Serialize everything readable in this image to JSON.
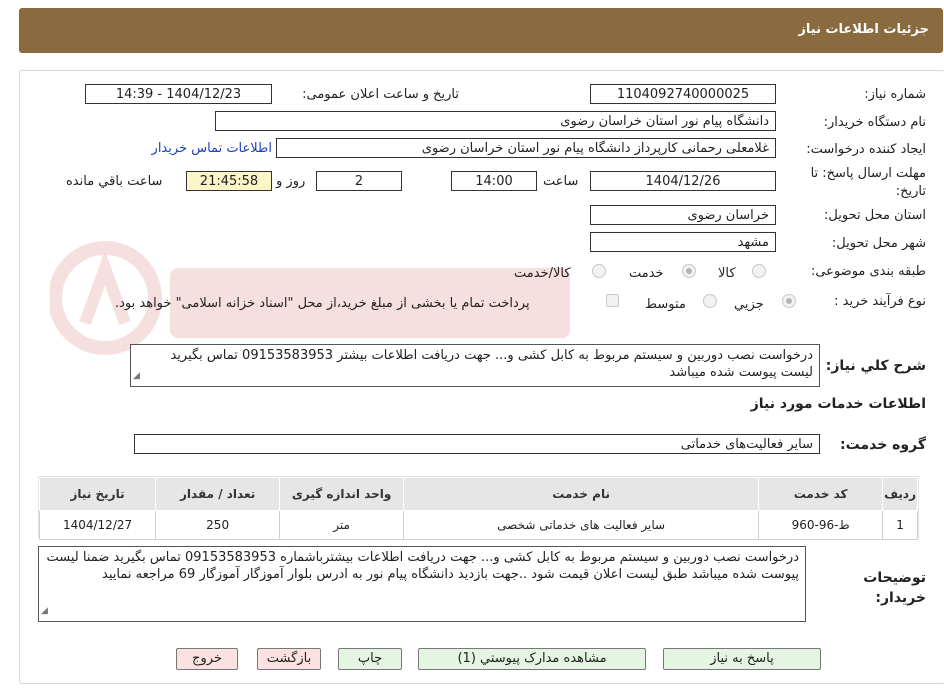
{
  "header": {
    "title": "جزئیات اطلاعات نیاز"
  },
  "form": {
    "need_number": {
      "label": "شماره نیاز:",
      "value": "1104092740000025"
    },
    "announce_datetime": {
      "label": "تاریخ و ساعت اعلان عمومی:",
      "value": "1404/12/23 - 14:39"
    },
    "buyer_org": {
      "label": "نام دستگاه خریدار:",
      "value": "دانشگاه پیام نور استان خراسان رضوی"
    },
    "requester": {
      "label": "ایجاد کننده درخواست:",
      "value": "غلامعلی رحمانی کارپرداز دانشگاه پیام نور استان خراسان رضوی",
      "contact_link": "اطلاعات تماس خریدار"
    },
    "deadline": {
      "label": "مهلت ارسال پاسخ: تا تاریخ:",
      "date": "1404/12/26",
      "time_label": "ساعت",
      "time": "14:00",
      "days": "2",
      "days_label": "روز و",
      "remaining": "21:45:58",
      "remaining_label": "ساعت باقي مانده"
    },
    "delivery_province": {
      "label": "استان محل تحویل:",
      "value": "خراسان رضوی"
    },
    "delivery_city": {
      "label": "شهر محل تحویل:",
      "value": "مشهد"
    },
    "category": {
      "label": "طبقه بندی موضوعی:",
      "options": [
        "کالا",
        "خدمت",
        "کالا/خدمت"
      ],
      "selected": "خدمت"
    },
    "purchase_type": {
      "label": "نوع فرآیند خرید :",
      "options": [
        "جزیي",
        "متوسط"
      ],
      "selected": "جزیي",
      "note": "پرداخت تمام یا بخشی از مبلغ خرید،از محل \"اسناد خزانه اسلامی\" خواهد بود."
    },
    "summary": {
      "label": "شرح کلي نياز:",
      "value": "درخواست نصب دوربین و سیستم مربوط به کابل کشی و...  جهت دریافت اطلاعات بیشتر 09153583953 تماس بگیرید لیست پیوست شده میباشد"
    }
  },
  "services": {
    "section_title": "اطلاعات خدمات مورد نیاز",
    "group_label": "گروه خدمت:",
    "group_value": "سایر فعالیت‌های خدماتی",
    "columns": [
      "ردیف",
      "کد خدمت",
      "نام خدمت",
      "واحد اندازه گیری",
      "تعداد / مقدار",
      "تاریخ نیاز"
    ],
    "rows": [
      [
        "1",
        "ط-96-960",
        "سایر فعالیت های خدماتی شخصی",
        "متر",
        "250",
        "1404/12/27"
      ]
    ]
  },
  "buyer_notes": {
    "label": "توضیحات خریدار:",
    "value": "درخواست نصب دوربین و سیستم مربوط به کابل کشی و...  جهت دریافت اطلاعات بیشترباشماره 09153583953 تماس بگیرید ضمنا لیست پیوست شده میباشد طبق لیست اعلان قیمت شود ..جهت بازدید دانشگاه پیام نور به ادرس بلوار آموزگار آموزگار 69 مراجعه نمایید"
  },
  "buttons": {
    "respond": "پاسخ به نیاز",
    "view_docs": "مشاهده مدارک پیوستي (1)",
    "print": "چاپ",
    "back": "بازگشت",
    "exit": "خروج"
  },
  "colors": {
    "header_bg": "#8a6b3f",
    "link": "#1a3fc2",
    "remaining_bg": "#fbf5c8",
    "green_btn": "#e4f6e1",
    "pink_btn": "#fbe1e1"
  }
}
